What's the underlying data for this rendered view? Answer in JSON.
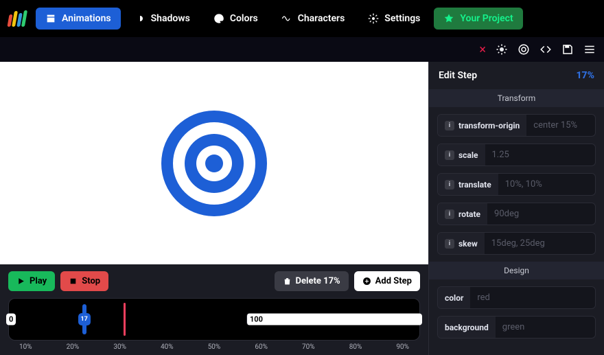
{
  "nav": {
    "items": [
      {
        "label": "Animations",
        "icon": "clapper",
        "active": true
      },
      {
        "label": "Shadows",
        "icon": "moon-sun",
        "active": false
      },
      {
        "label": "Colors",
        "icon": "palette",
        "active": false
      },
      {
        "label": "Characters",
        "icon": "wave",
        "active": false
      },
      {
        "label": "Settings",
        "icon": "gear",
        "active": false
      }
    ],
    "project": {
      "label": "Your Project",
      "icon": "star"
    }
  },
  "actionbar": {
    "close": "×"
  },
  "controls": {
    "play": "Play",
    "stop": "Stop",
    "delete": "Delete 17%",
    "add": "Add Step"
  },
  "timeline": {
    "start": "0",
    "end": "100",
    "step_marker": {
      "percent": 17,
      "label": "17"
    },
    "playhead_percent": 27,
    "ticks": [
      "10%",
      "20%",
      "30%",
      "40%",
      "50%",
      "60%",
      "70%",
      "80%",
      "90%"
    ]
  },
  "panel": {
    "title": "Edit Step",
    "percent": "17%",
    "sections": {
      "transform": {
        "title": "Transform",
        "fields": [
          {
            "label": "transform-origin",
            "placeholder": "center 15%"
          },
          {
            "label": "scale",
            "placeholder": "1.25"
          },
          {
            "label": "translate",
            "placeholder": "10%, 10%"
          },
          {
            "label": "rotate",
            "placeholder": "90deg"
          },
          {
            "label": "skew",
            "placeholder": "15deg, 25deg"
          }
        ]
      },
      "design": {
        "title": "Design",
        "fields": [
          {
            "label": "color",
            "placeholder": "red"
          },
          {
            "label": "background",
            "placeholder": "green"
          }
        ]
      }
    }
  },
  "colors": {
    "brand": "#1d5fd6",
    "play": "#18b95b",
    "stop": "#e24a4a",
    "playhead": "#f43f5e"
  }
}
